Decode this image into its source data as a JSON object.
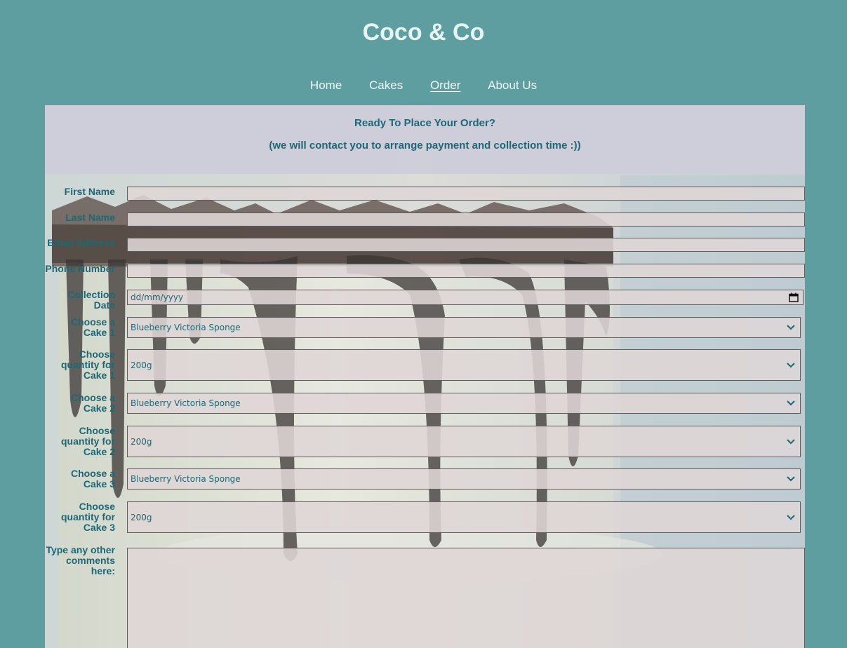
{
  "site": {
    "title": "Coco & Co"
  },
  "nav": {
    "items": [
      {
        "label": "Home"
      },
      {
        "label": "Cakes"
      },
      {
        "label": "Order",
        "active": true
      },
      {
        "label": "About Us"
      }
    ]
  },
  "intro": {
    "heading": "Ready To Place Your Order?",
    "subheading": "(we will contact you to arrange payment and collection time :))"
  },
  "form": {
    "first_name_label": "First Name",
    "last_name_label": "Last Name",
    "email_label": "Email Address",
    "phone_label": "Phone Number",
    "collection_date_label": "Collection Date",
    "collection_date_placeholder": "dd/mm/yyyy",
    "cake1_label": "Choose a Cake 1",
    "cake1_value": "Blueberry Victoria Sponge",
    "qty1_label": "Choose quantity for Cake 1",
    "qty1_value": "200g",
    "cake2_label": "Choose a Cake 2",
    "cake2_value": "Blueberry Victoria Sponge",
    "qty2_label": "Choose quantity for Cake 2",
    "qty2_value": "200g",
    "cake3_label": "Choose a Cake 3",
    "cake3_value": "Blueberry Victoria Sponge",
    "qty3_label": "Choose quantity for Cake 3",
    "qty3_value": "200g",
    "comments_label": "Type any other comments here:"
  },
  "colors": {
    "page_background": "#5f9ea0",
    "title_text": "#e6f4f4",
    "form_text": "#1e6775",
    "field_background": "#ded6d6",
    "intro_background": "#cdceda"
  },
  "icons": {
    "select_arrow": "chevron-down-icon",
    "date_picker": "calendar-icon",
    "background_photo": "chocolate-drip-cake-image"
  }
}
